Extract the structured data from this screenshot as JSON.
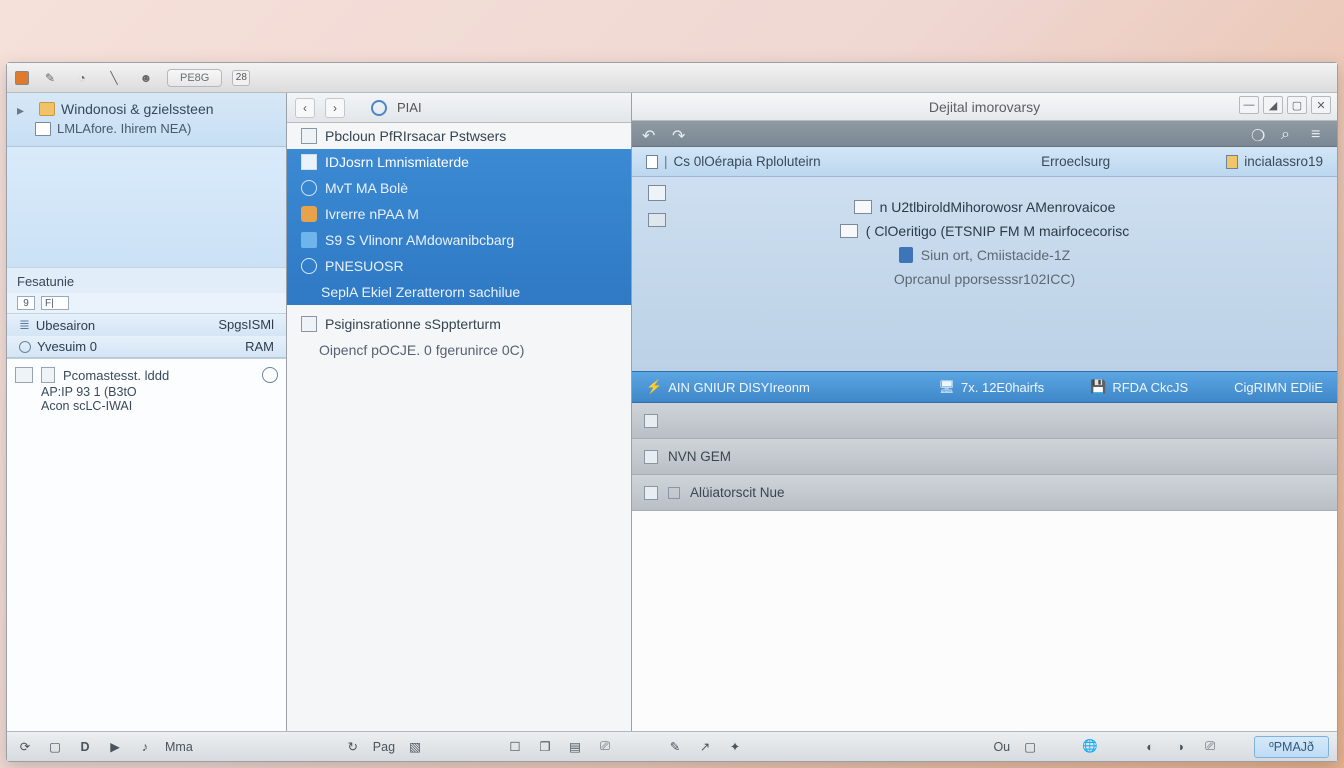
{
  "top_toolbar": {
    "pill_label": "PE8G",
    "mini_label": "28"
  },
  "left": {
    "tree_root": "Windonosi & gzielssteen",
    "tree_child": "LMLAfore. Ihirem NEA)",
    "section_feature": "Fesatunie",
    "search_hint1": "9",
    "search_hint2": "F|",
    "rows": [
      {
        "left": "Ubesairon",
        "right": "SpgsISMl"
      },
      {
        "left": "Yvesuim 0",
        "right": "RAM"
      }
    ],
    "block_header": "Pcomastesst. lddd",
    "block_line1": "AP:IP 93 1 (B3tO",
    "block_line2": "Acon scLC-IWAI"
  },
  "mid": {
    "toolbar_label": "PIAI",
    "items_top": [
      "Pbcloun PfRIrsacar Pstwsers"
    ],
    "selected_group": [
      "IDJosrn Lmnismiaterde",
      "MvT MA Bolè",
      "Ivrerre nPAA M",
      "S9 S Vlinonr AMdowanibcbarg",
      "PNESUOSR",
      "SeplA Ekiel Zeratterorn sachilue"
    ],
    "items_bottom": [
      "Psiginsrationne sSppterturm",
      "Oipencf pOCJE. 0 fgerunirce 0C)"
    ]
  },
  "right": {
    "window_title": "Dejital imorovarsy",
    "tabs": {
      "t1": "Cs 0lOérapia Rploluteirn",
      "t2": "Erroeclsurg",
      "t3": "incialassro19"
    },
    "content": {
      "l1": "n U2tlbiroldMihorowosr AMenrovaicoe",
      "l2": "( ClOeritigo (ETSNIP FM M mairfocecorisc",
      "l3": "Siun ort, Cmiistacide-1Z",
      "l4": "Oprcanul pporsesssr102ICC)"
    },
    "ribbon": {
      "seg1": "AIN GNIUR DISYIreonm",
      "seg2": "7x. 12E0hairfs",
      "seg3": "RFDA CkcJS",
      "seg4": "CigRIMN EDliE"
    },
    "bars": {
      "b1": "",
      "b2": "NVN GEM",
      "b3": "Alüiatorscit Nue"
    }
  },
  "taskbar": {
    "label_mma": "Mma",
    "label_pag": "Pag",
    "label_ou": "Ou",
    "chip": "ºPMAJð"
  }
}
